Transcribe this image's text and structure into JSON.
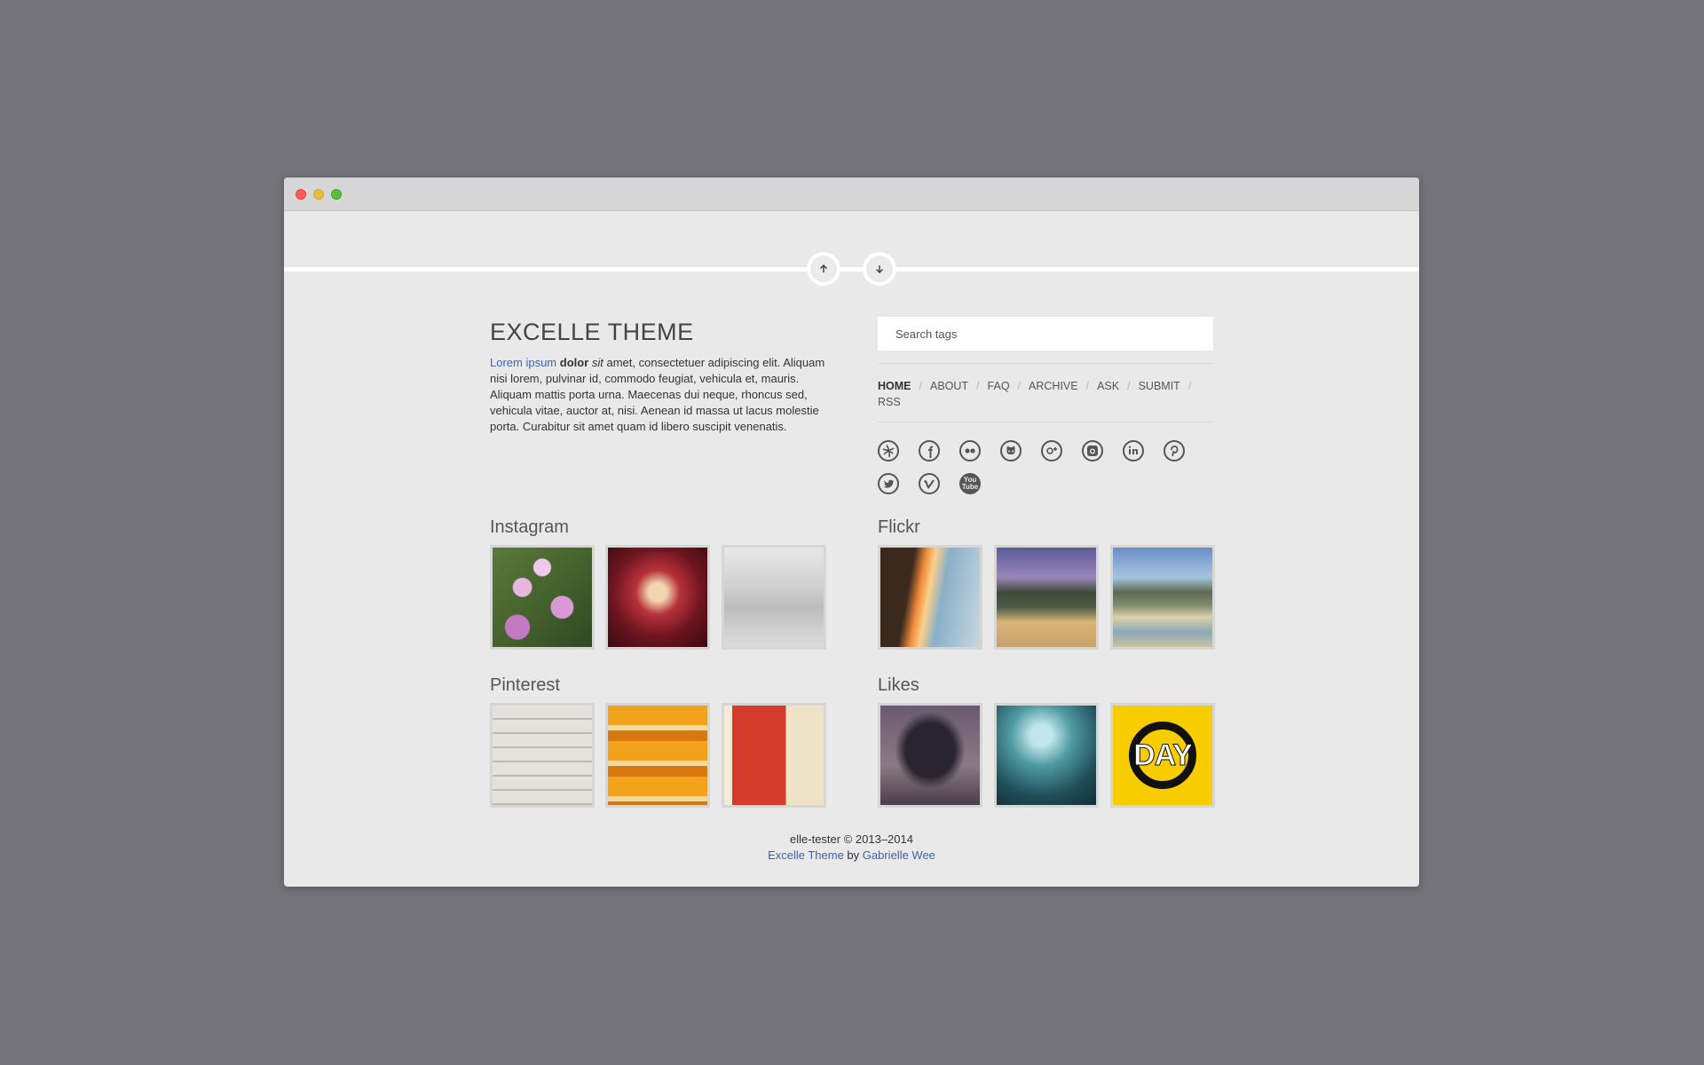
{
  "window": {
    "controls": [
      "close",
      "minimize",
      "maximize"
    ]
  },
  "pager": {
    "up_icon": "arrow-up-icon",
    "down_icon": "arrow-down-icon"
  },
  "blog": {
    "title": "EXCELLE THEME",
    "description": {
      "link": "Lorem ipsum",
      "bold": "dolor",
      "italic": "sit",
      "rest": " amet, consectetuer adipiscing elit. Aliquam nisi lorem, pulvinar id, commodo feugiat, vehicula et, mauris. Aliquam mattis porta urna. Maecenas dui neque, rhoncus sed, vehicula vitae, auctor at, nisi. Aenean id massa ut lacus molestie porta. Curabitur sit amet quam id libero suscipit venenatis."
    }
  },
  "search": {
    "placeholder": "Search tags"
  },
  "nav": {
    "home": "HOME",
    "about": "ABOUT",
    "faq": "FAQ",
    "archive": "ARCHIVE",
    "ask": "ASK",
    "submit": "SUBMIT",
    "rss": "RSS",
    "separator": "/"
  },
  "social": [
    "dribbble-icon",
    "facebook-icon",
    "flickr-icon",
    "github-icon",
    "google-plus-icon",
    "instagram-icon",
    "linkedin-icon",
    "pinterest-icon",
    "twitter-icon",
    "vimeo-icon",
    "youtube-icon"
  ],
  "social_text": {
    "youtube_top": "You",
    "youtube_bottom": "Tube"
  },
  "sections": {
    "instagram": "Instagram",
    "flickr": "Flickr",
    "pinterest": "Pinterest",
    "likes": "Likes"
  },
  "likes_badge": "DAY",
  "footer": {
    "copyright": "elle-tester © 2013–2014",
    "theme_link": "Excelle Theme",
    "by": " by ",
    "author_link": "Gabrielle Wee"
  },
  "colors": {
    "background": "#74737a",
    "page": "#e9e9e9",
    "link": "#3b64a8"
  }
}
